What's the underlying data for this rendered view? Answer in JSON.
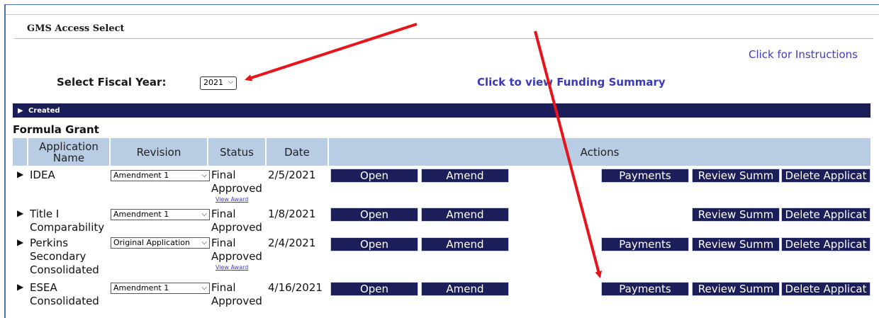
{
  "header": {
    "title": "GMS Access Select",
    "instructions_link": "Click for Instructions",
    "fiscal_year_label": "Select Fiscal Year:",
    "fiscal_year_value": "2021",
    "funding_summary_link": "Click to view Funding Summary"
  },
  "section": {
    "created_label": "Created",
    "group_title": "Formula Grant"
  },
  "table": {
    "columns": [
      "Application Name",
      "Revision",
      "Status",
      "Date",
      "Actions"
    ],
    "rows": [
      {
        "name": "IDEA",
        "name_line2": "",
        "name_line3": "",
        "revision": "Amendment 1",
        "status1": "Final",
        "status2": "Approved",
        "view_award": "View Award",
        "date": "2/5/2021"
      },
      {
        "name": "Title I",
        "name_line2": "Comparability",
        "name_line3": "",
        "revision": "Amendment 1",
        "status1": "Final",
        "status2": "Approved",
        "view_award": "",
        "date": "1/8/2021"
      },
      {
        "name": "Perkins",
        "name_line2": "Secondary",
        "name_line3": "Consolidated",
        "revision": "Original Application",
        "status1": "Final",
        "status2": "Approved",
        "view_award": "View Award",
        "date": "2/4/2021"
      },
      {
        "name": "ESEA",
        "name_line2": "Consolidated",
        "name_line3": "",
        "revision": "Amendment 1",
        "status1": "Final",
        "status2": "Approved",
        "view_award": "",
        "date": "4/16/2021"
      }
    ]
  },
  "actions": {
    "open": "Open",
    "amend": "Amend",
    "payments": "Payments",
    "review": "Review Summ",
    "delete": "Delete Applicat"
  },
  "colors": {
    "navy": "#1b1e58",
    "header_blue": "#b8cce4",
    "link_blue": "#3c3cc8",
    "annotation_red": "#e8141b"
  }
}
